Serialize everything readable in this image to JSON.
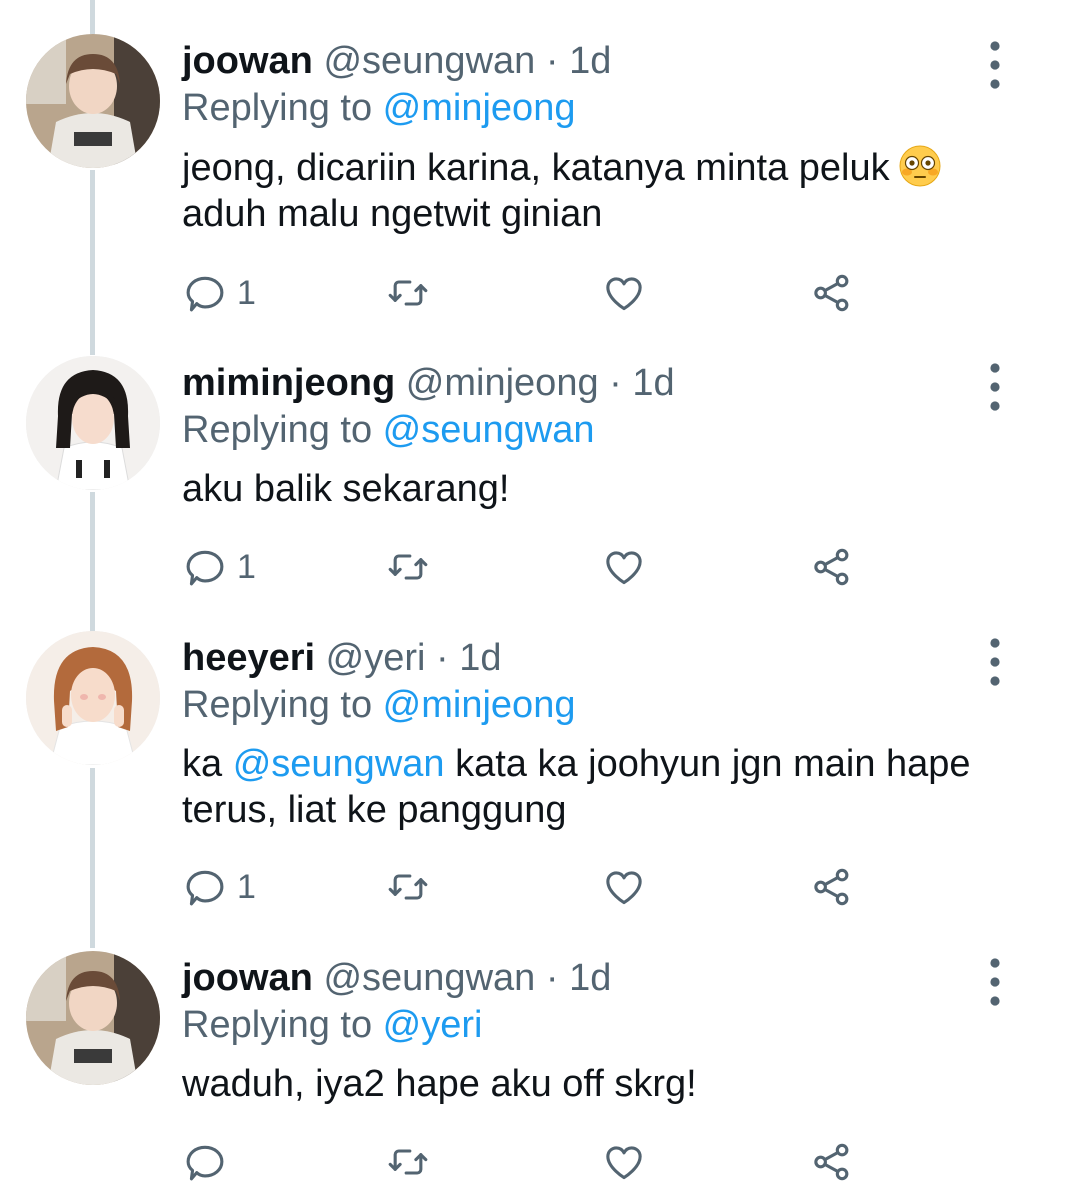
{
  "colors": {
    "accent": "#1d9bf0",
    "text": "#0f1419",
    "muted": "#536471",
    "thread_line": "#cfd9de"
  },
  "tweets": [
    {
      "display_name": "joowan",
      "handle": "@seungwan",
      "dot": "·",
      "time": "1d",
      "replying_prefix": "Replying to ",
      "replying_to": "@minjeong",
      "text_line1": "jeong, dicariin karina, katanya minta peluk",
      "text_line2": "aduh malu ngetwit ginian",
      "emoji": "flushed-face",
      "reply_count": "1"
    },
    {
      "display_name": "miminjeong",
      "handle": "@minjeong",
      "dot": "·",
      "time": "1d",
      "replying_prefix": "Replying to ",
      "replying_to": "@seungwan",
      "text": "aku balik sekarang!",
      "reply_count": "1"
    },
    {
      "display_name": "heeyeri",
      "handle": "@yeri",
      "dot": "·",
      "time": "1d",
      "replying_prefix": "Replying to ",
      "replying_to": "@minjeong",
      "text_prefix": "ka ",
      "text_mention": "@seungwan",
      "text_rest": " kata ka joohyun jgn main hape",
      "text_line2": "terus, liat ke panggung",
      "reply_count": "1"
    },
    {
      "display_name": "joowan",
      "handle": "@seungwan",
      "dot": "·",
      "time": "1d",
      "replying_prefix": "Replying to ",
      "replying_to": "@yeri",
      "text": "waduh, iya2 hape aku off skrg!",
      "reply_count": ""
    }
  ]
}
